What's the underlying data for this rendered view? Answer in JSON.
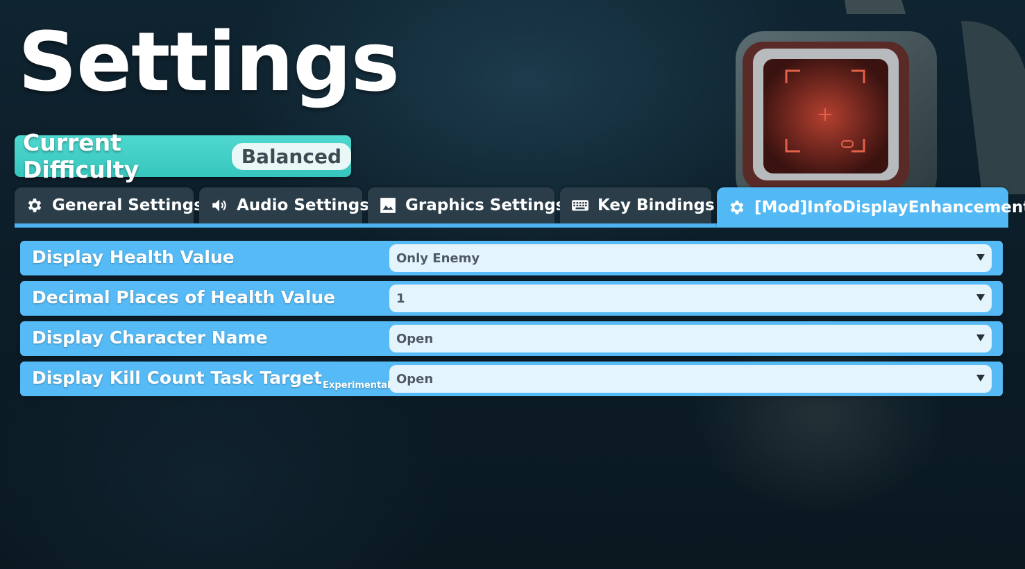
{
  "page": {
    "title": "Settings"
  },
  "difficulty": {
    "label": "Current Difficulty",
    "value": "Balanced"
  },
  "tabs": [
    {
      "label": "General Settings",
      "icon": "gear-icon",
      "active": false
    },
    {
      "label": "Audio Settings",
      "icon": "speaker-icon",
      "active": false
    },
    {
      "label": "Graphics Settings",
      "icon": "image-icon",
      "active": false
    },
    {
      "label": "Key Bindings",
      "icon": "keyboard-icon",
      "active": true
    },
    {
      "label": "[Mod]InfoDisplayEnhancement",
      "icon": "gear-icon",
      "active": true
    }
  ],
  "settings": [
    {
      "label": "Display Health Value",
      "suffix": "",
      "value": "Only Enemy"
    },
    {
      "label": "Decimal Places of Health Value",
      "suffix": "",
      "value": "1"
    },
    {
      "label": "Display Character Name",
      "suffix": "",
      "value": "Open"
    },
    {
      "label": "Display Kill Count Task Target",
      "suffix": "Experimental",
      "value": "Open"
    }
  ],
  "colors": {
    "accent_blue": "#55baf5",
    "difficulty_teal": "#4fd8cf",
    "tab_inactive": "#2b3d49",
    "dropdown_bg": "#e3f4fd"
  }
}
